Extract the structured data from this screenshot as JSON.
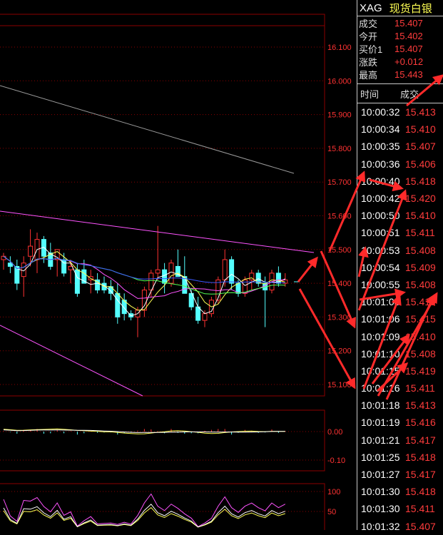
{
  "header": {
    "symbol": "XAG",
    "name": "现货白银"
  },
  "quote": [
    {
      "label": "成交",
      "value": "15.407"
    },
    {
      "label": "今开",
      "value": "15.402"
    },
    {
      "label": "买价1",
      "value": "15.407"
    },
    {
      "label": "涨跌",
      "value": "+0.012"
    },
    {
      "label": "最高",
      "value": "15.443"
    }
  ],
  "ticks_header": {
    "time": "时间",
    "price": "成交"
  },
  "ticks": [
    {
      "time": "10:00:32",
      "price": "15.413"
    },
    {
      "time": "10:00:34",
      "price": "15.410"
    },
    {
      "time": "10:00:35",
      "price": "15.407"
    },
    {
      "time": "10:00:36",
      "price": "15.406"
    },
    {
      "time": "10:00:40",
      "price": "15.418"
    },
    {
      "time": "10:00:42",
      "price": "15.420"
    },
    {
      "time": "10:00:50",
      "price": "15.410"
    },
    {
      "time": "10:00:51",
      "price": "15.411"
    },
    {
      "time": "10:00:53",
      "price": "15.408"
    },
    {
      "time": "10:00:54",
      "price": "15.409"
    },
    {
      "time": "10:00:55",
      "price": "15.408"
    },
    {
      "time": "10:01:05",
      "price": "15.419"
    },
    {
      "time": "10:01:06",
      "price": "15.415"
    },
    {
      "time": "10:01:09",
      "price": "15.410"
    },
    {
      "time": "10:01:10",
      "price": "15.408"
    },
    {
      "time": "10:01:15",
      "price": "15.419"
    },
    {
      "time": "10:01:16",
      "price": "15.411"
    },
    {
      "time": "10:01:18",
      "price": "15.413"
    },
    {
      "time": "10:01:19",
      "price": "15.416"
    },
    {
      "time": "10:01:21",
      "price": "15.417"
    },
    {
      "time": "10:01:25",
      "price": "15.418"
    },
    {
      "time": "10:01:27",
      "price": "15.417"
    },
    {
      "time": "10:01:30",
      "price": "15.418"
    },
    {
      "time": "10:01:30",
      "price": "15.411"
    },
    {
      "time": "10:01:32",
      "price": "15.407"
    }
  ],
  "chart_data": {
    "type": "candlestick",
    "price_axis": {
      "ticks": [
        16.1,
        16.0,
        15.9,
        15.8,
        15.7,
        15.6,
        15.5,
        15.4,
        15.3,
        15.2,
        15.1
      ],
      "tick_labels": [
        "16.100",
        "16.000",
        "15.900",
        "15.800",
        "15.700",
        "15.600",
        "15.500",
        "15.400",
        "15.300",
        "15.200",
        "15.100"
      ],
      "ylim": [
        15.08,
        16.16
      ]
    },
    "candles": [
      {
        "o": 15.47,
        "h": 15.49,
        "l": 15.44,
        "c": 15.48
      },
      {
        "o": 15.46,
        "h": 15.48,
        "l": 15.43,
        "c": 15.45
      },
      {
        "o": 15.45,
        "h": 15.47,
        "l": 15.38,
        "c": 15.4
      },
      {
        "o": 15.42,
        "h": 15.48,
        "l": 15.36,
        "c": 15.46
      },
      {
        "o": 15.48,
        "h": 15.56,
        "l": 15.45,
        "c": 15.51
      },
      {
        "o": 15.47,
        "h": 15.55,
        "l": 15.43,
        "c": 15.53
      },
      {
        "o": 15.53,
        "h": 15.54,
        "l": 15.46,
        "c": 15.48
      },
      {
        "o": 15.49,
        "h": 15.52,
        "l": 15.44,
        "c": 15.45
      },
      {
        "o": 15.47,
        "h": 15.5,
        "l": 15.42,
        "c": 15.5
      },
      {
        "o": 15.47,
        "h": 15.49,
        "l": 15.42,
        "c": 15.43
      },
      {
        "o": 15.44,
        "h": 15.47,
        "l": 15.4,
        "c": 15.45
      },
      {
        "o": 15.44,
        "h": 15.46,
        "l": 15.36,
        "c": 15.37
      },
      {
        "o": 15.44,
        "h": 15.47,
        "l": 15.4,
        "c": 15.4
      },
      {
        "o": 15.41,
        "h": 15.44,
        "l": 15.37,
        "c": 15.42
      },
      {
        "o": 15.41,
        "h": 15.43,
        "l": 15.37,
        "c": 15.38
      },
      {
        "o": 15.4,
        "h": 15.42,
        "l": 15.37,
        "c": 15.38
      },
      {
        "o": 15.39,
        "h": 15.41,
        "l": 15.35,
        "c": 15.37
      },
      {
        "o": 15.37,
        "h": 15.4,
        "l": 15.28,
        "c": 15.3
      },
      {
        "o": 15.35,
        "h": 15.37,
        "l": 15.29,
        "c": 15.31
      },
      {
        "o": 15.31,
        "h": 15.32,
        "l": 15.29,
        "c": 15.3
      },
      {
        "o": 15.3,
        "h": 15.33,
        "l": 15.24,
        "c": 15.32
      },
      {
        "o": 15.32,
        "h": 15.39,
        "l": 15.3,
        "c": 15.38
      },
      {
        "o": 15.38,
        "h": 15.44,
        "l": 15.36,
        "c": 15.43
      },
      {
        "o": 15.43,
        "h": 15.57,
        "l": 15.41,
        "c": 15.44
      },
      {
        "o": 15.44,
        "h": 15.46,
        "l": 15.37,
        "c": 15.4
      },
      {
        "o": 15.4,
        "h": 15.47,
        "l": 15.39,
        "c": 15.46
      },
      {
        "o": 15.45,
        "h": 15.5,
        "l": 15.42,
        "c": 15.42
      },
      {
        "o": 15.42,
        "h": 15.48,
        "l": 15.37,
        "c": 15.37
      },
      {
        "o": 15.37,
        "h": 15.38,
        "l": 15.32,
        "c": 15.33
      },
      {
        "o": 15.33,
        "h": 15.36,
        "l": 15.28,
        "c": 15.29
      },
      {
        "o": 15.29,
        "h": 15.32,
        "l": 15.27,
        "c": 15.31
      },
      {
        "o": 15.31,
        "h": 15.36,
        "l": 15.3,
        "c": 15.35
      },
      {
        "o": 15.35,
        "h": 15.42,
        "l": 15.34,
        "c": 15.41
      },
      {
        "o": 15.41,
        "h": 15.5,
        "l": 15.39,
        "c": 15.47
      },
      {
        "o": 15.47,
        "h": 15.48,
        "l": 15.38,
        "c": 15.4
      },
      {
        "o": 15.4,
        "h": 15.41,
        "l": 15.36,
        "c": 15.37
      },
      {
        "o": 15.37,
        "h": 15.42,
        "l": 15.36,
        "c": 15.41
      },
      {
        "o": 15.41,
        "h": 15.44,
        "l": 15.38,
        "c": 15.43
      },
      {
        "o": 15.43,
        "h": 15.44,
        "l": 15.39,
        "c": 15.4
      },
      {
        "o": 15.4,
        "h": 15.42,
        "l": 15.27,
        "c": 15.38
      },
      {
        "o": 15.38,
        "h": 15.44,
        "l": 15.37,
        "c": 15.43
      },
      {
        "o": 15.43,
        "h": 15.45,
        "l": 15.39,
        "c": 15.4
      },
      {
        "o": 15.4,
        "h": 15.43,
        "l": 15.39,
        "c": 15.41
      }
    ],
    "sub1_axis": {
      "ticks": [
        0.0,
        -0.1
      ],
      "tick_labels": [
        "0.00",
        "-0.10"
      ]
    },
    "sub2_axis": {
      "ticks": [
        100,
        50
      ],
      "tick_labels": [
        "100",
        "50"
      ]
    },
    "colors": {
      "up": "#ff3232",
      "down": "#54ffff",
      "grid": "#8b0000",
      "axis_text": "#ff3232",
      "arrow": "#ff2a2a"
    },
    "grid": true
  }
}
